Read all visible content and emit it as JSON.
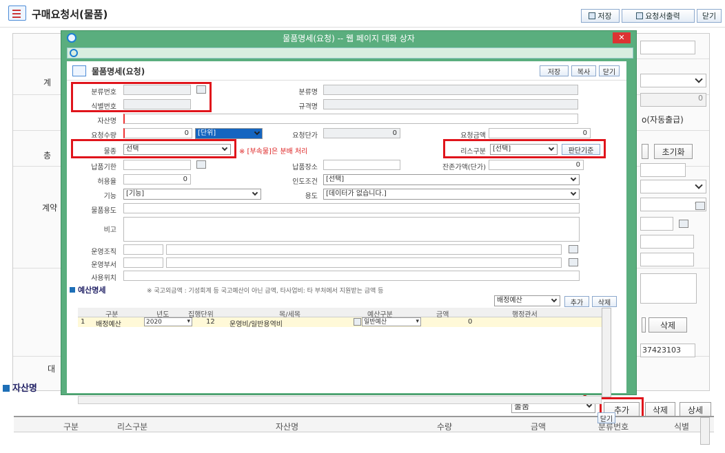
{
  "page": {
    "title": "구매요청서(물품)",
    "icon": "document-list-icon"
  },
  "toolbar": {
    "save": "저장",
    "print": "요청서출력",
    "close": "닫기"
  },
  "background": {
    "labels": {
      "gye": "계",
      "chong": "총",
      "gyeyak": "계약",
      "dae": "대"
    },
    "auto_shipping": "o(자동출급)",
    "zero_value": "0",
    "reset_button": "초기화",
    "delete_button": "삭제",
    "account_no": "37423103",
    "section_title": "자산명"
  },
  "dialog": {
    "window_title": "물품명세(요청) -- 웹 페이지 대화 상자",
    "close_glyph": "✕",
    "header_title": "물품명세(요청)",
    "buttons": {
      "save": "저장",
      "copy": "복사",
      "close": "닫기"
    },
    "fields": {
      "class_no": "분류번호",
      "class_name": "분류명",
      "id_no": "식별번호",
      "spec_name": "규격명",
      "asset_name": "자산명",
      "req_qty": "요청수량",
      "req_qty_value": "0",
      "unit_select": "[단위]",
      "req_unit_price": "요청단가",
      "req_unit_price_value": "0",
      "req_amount": "요청금액",
      "req_amount_value": "0",
      "item_type": "물종",
      "item_type_value": "선택",
      "item_type_note": "※ [부속물]은 분배 처리",
      "lease_type": "리스구분",
      "lease_type_value": "[선택]",
      "lease_button": "판단기준",
      "delivery_deadline": "납품기한",
      "delivery_place": "납품장소",
      "residual": "잔존가액(단가)",
      "residual_value": "0",
      "tolerance": "허용율",
      "tolerance_value": "0",
      "handover": "인도조건",
      "handover_value": "[선택]",
      "function": "기능",
      "function_value": "[기능]",
      "usage": "용도",
      "usage_value": "[데이터가 없습니다.]",
      "item_usage": "물품용도",
      "remarks": "비고",
      "op_org": "운영조직",
      "op_dept": "운영부서",
      "use_location": "사용위치"
    },
    "budget": {
      "title": "예산명세",
      "note": "※ 국고외금액 : 기성회계 등 국고예산이 아닌 금액, 타사업비: 타 부처에서 지원받는 금액 등",
      "select_value": "배정예산",
      "add": "추가",
      "delete": "삭제",
      "columns": [
        "구분",
        "년도",
        "집행단위",
        "목/세목",
        "예산구분",
        "금액",
        "행정관서"
      ],
      "rows": [
        {
          "no": "1",
          "type": "배정예산",
          "year": "2020",
          "unit": "12",
          "item": "운영비/일반용역비",
          "budget_type": "일반예산",
          "amount": "0",
          "office": ""
        }
      ],
      "close": "닫기"
    }
  },
  "bottom": {
    "select_value": "물품",
    "add": "추가",
    "delete": "삭제",
    "detail": "상세",
    "columns": [
      "구분",
      "리스구분",
      "자산명",
      "수량",
      "금액",
      "분류번호",
      "식별"
    ]
  }
}
